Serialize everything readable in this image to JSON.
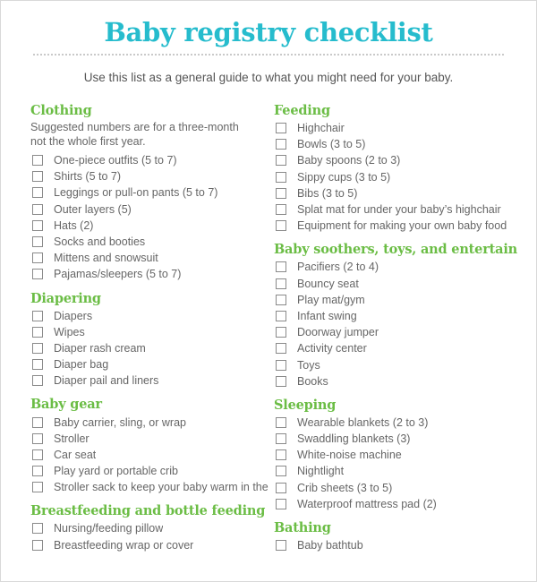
{
  "header": {
    "title": "Baby registry checklist",
    "subtitle": "Use this list as a general guide to what you might need for your baby."
  },
  "colors": {
    "title": "#26bccd",
    "section_heading": "#6bbd45",
    "body_text": "#666666"
  },
  "left_column": {
    "sections": [
      {
        "title": "Clothing",
        "note": "Suggested numbers are for a three-month not the whole first year.",
        "items": [
          {
            "label": "One-piece outfits (5 to 7)",
            "checked": false
          },
          {
            "label": "Shirts (5 to 7)",
            "checked": false
          },
          {
            "label": "Leggings or pull-on pants (5 to 7)",
            "checked": false
          },
          {
            "label": "Outer layers (5)",
            "checked": false
          },
          {
            "label": "Hats (2)",
            "checked": false
          },
          {
            "label": "Socks and booties",
            "checked": false
          },
          {
            "label": "Mittens and snowsuit",
            "checked": false
          },
          {
            "label": "Pajamas/sleepers (5 to 7)",
            "checked": false
          }
        ]
      },
      {
        "title": "Diapering",
        "items": [
          {
            "label": "Diapers",
            "checked": false
          },
          {
            "label": "Wipes",
            "checked": false
          },
          {
            "label": "Diaper rash cream",
            "checked": false
          },
          {
            "label": "Diaper bag",
            "checked": false
          },
          {
            "label": "Diaper pail and liners",
            "checked": false
          }
        ]
      },
      {
        "title": "Baby gear",
        "items": [
          {
            "label": "Baby carrier, sling, or wrap",
            "checked": false
          },
          {
            "label": "Stroller",
            "checked": false
          },
          {
            "label": "Car seat",
            "checked": false
          },
          {
            "label": "Play yard or portable crib",
            "checked": false
          },
          {
            "label": "Stroller sack to keep your baby warm in the",
            "checked": false
          }
        ]
      },
      {
        "title": "Breastfeeding and bottle feeding",
        "items": [
          {
            "label": "Nursing/feeding pillow",
            "checked": false
          },
          {
            "label": "Breastfeeding wrap or cover",
            "checked": false
          }
        ]
      }
    ]
  },
  "right_column": {
    "sections": [
      {
        "title": "Feeding",
        "items": [
          {
            "label": "Highchair",
            "checked": false
          },
          {
            "label": "Bowls (3 to 5)",
            "checked": false
          },
          {
            "label": "Baby spoons (2 to 3)",
            "checked": false
          },
          {
            "label": "Sippy cups (3 to 5)",
            "checked": false
          },
          {
            "label": "Bibs (3 to 5)",
            "checked": false
          },
          {
            "label": "Splat mat for under your baby’s highchair",
            "checked": false
          },
          {
            "label": "Equipment for making your own baby food",
            "checked": false
          }
        ]
      },
      {
        "title": "Baby soothers, toys, and entertain",
        "items": [
          {
            "label": "Pacifiers (2 to 4)",
            "checked": false
          },
          {
            "label": "Bouncy seat",
            "checked": false
          },
          {
            "label": "Play mat/gym",
            "checked": false
          },
          {
            "label": "Infant swing",
            "checked": false
          },
          {
            "label": "Doorway jumper",
            "checked": false
          },
          {
            "label": "Activity center",
            "checked": false
          },
          {
            "label": "Toys",
            "checked": false
          },
          {
            "label": "Books",
            "checked": false
          }
        ]
      },
      {
        "title": "Sleeping",
        "items": [
          {
            "label": "Wearable blankets (2 to 3)",
            "checked": false
          },
          {
            "label": "Swaddling blankets (3)",
            "checked": false
          },
          {
            "label": "White-noise machine",
            "checked": false
          },
          {
            "label": "Nightlight",
            "checked": false
          },
          {
            "label": "Crib sheets (3 to 5)",
            "checked": false
          },
          {
            "label": "Waterproof mattress pad (2)",
            "checked": false
          }
        ]
      },
      {
        "title": "Bathing",
        "items": [
          {
            "label": "Baby bathtub",
            "checked": false
          }
        ]
      }
    ]
  }
}
